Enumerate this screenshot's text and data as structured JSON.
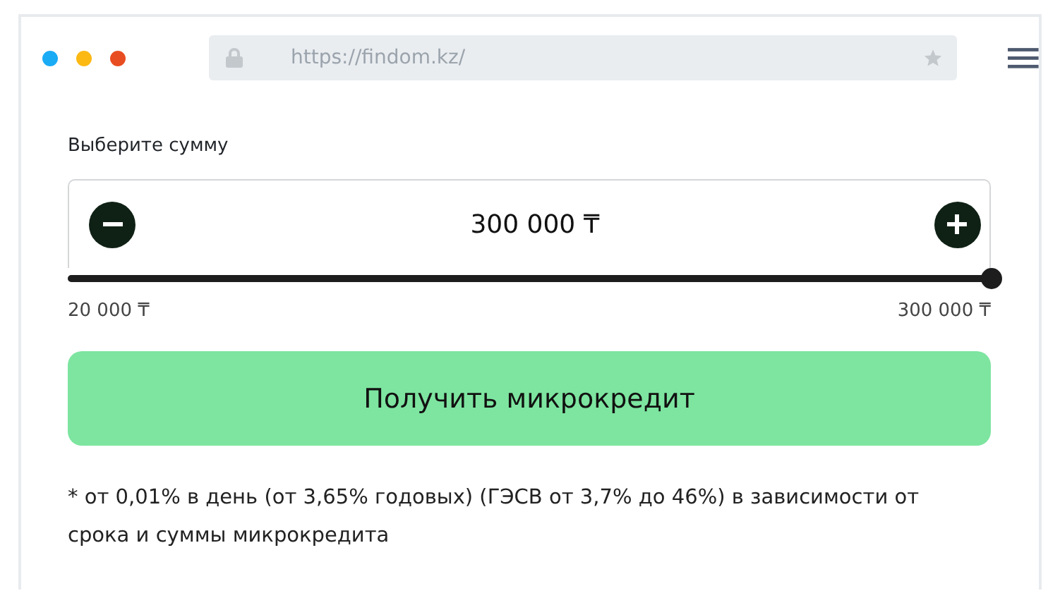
{
  "browser": {
    "url": "https://findom.kz/"
  },
  "amount": {
    "label": "Выберите сумму",
    "value": "300 000 ₸",
    "level": 1,
    "min_label": "20 000 ₸",
    "max_label": "300 000 ₸"
  },
  "button": {
    "label": "Получить микрокредит"
  },
  "footnote": "* от 0,01% в день (от 3,65% годовых) (ГЭСВ от 3,7% до 46%) в зависимости от срока и суммы микрокредита"
}
